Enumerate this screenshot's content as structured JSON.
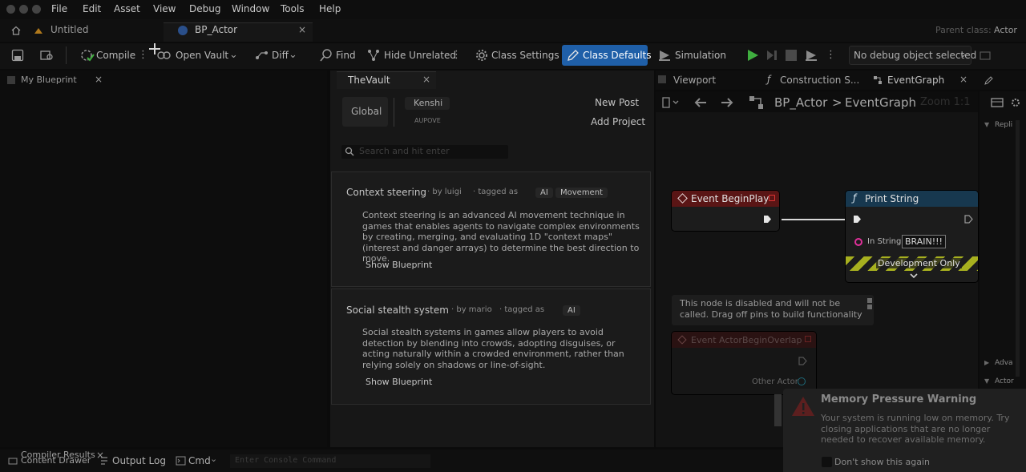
{
  "menu": [
    "File",
    "Edit",
    "Asset",
    "View",
    "Debug",
    "Window",
    "Tools",
    "Help"
  ],
  "tabs": {
    "untitled": "Untitled",
    "bp_actor": "BP_Actor",
    "close": "×"
  },
  "parent_class": {
    "label": "Parent class:",
    "value": "Actor"
  },
  "toolbar": {
    "compile": "Compile",
    "open_vault": "Open Vault",
    "diff": "Diff",
    "find": "Find",
    "hide_unrelated": "Hide Unrelated",
    "class_settings": "Class Settings",
    "class_defaults": "Class Defaults",
    "simulation": "Simulation",
    "debug_object": "No debug object selected"
  },
  "left_panel": {
    "title": "My Blueprint",
    "close": "×"
  },
  "vault": {
    "title": "TheVault",
    "close": "×",
    "scope": "Global",
    "user_name": "Kenshi",
    "user_sub": "AUPOVE",
    "new_post": "New Post",
    "add_project": "Add Project",
    "search_placeholder": "Search and hit enter",
    "posts": [
      {
        "title": "Context steering",
        "author": "by luigi",
        "tagged": "tagged as",
        "tags": [
          "AI",
          "Movement"
        ],
        "description": "Context steering is an advanced AI movement technique in games that enables agents to navigate complex environments by creating, merging, and evaluating 1D \"context maps\" (interest and danger arrays) to determine the best direction to move.",
        "show": "Show Blueprint"
      },
      {
        "title": "Social stealth system",
        "author": "by mario",
        "tagged": "tagged as",
        "tags": [
          "AI"
        ],
        "description": "Social stealth systems in games allow players to avoid detection by blending into crowds, adopting disguises, or acting naturally within a crowded environment, rather than relying solely on shadows or line-of-sight.",
        "show": "Show Blueprint"
      }
    ]
  },
  "graph_tabs": {
    "viewport": "Viewport",
    "construction": "Construction S...",
    "eventgraph": "EventGraph"
  },
  "breadcrumb": {
    "root": "BP_Actor",
    "sep": ">",
    "current": "EventGraph",
    "zoom": "Zoom 1:1"
  },
  "nodes": {
    "begin_play": "Event BeginPlay",
    "print_string": "Print String",
    "in_string_label": "In String",
    "in_string_value": "BRAIN!!!",
    "dev_only": "Development Only",
    "disabled_note": "This node is disabled and will not be called. Drag off pins to build functionality",
    "overlap": "Event ActorBeginOverlap",
    "other_actor": "Other Actor"
  },
  "details_panel": {
    "item1": "Repli",
    "item2": "Adva",
    "item3": "Actor"
  },
  "bottom": {
    "content_drawer": "Content Drawer",
    "compiler_results": "Compiler Results",
    "output_log": "Output Log",
    "cmd": "Cmd",
    "console_placeholder": "Enter Console Command"
  },
  "notification": {
    "title": "Memory Pressure Warning",
    "body": "Your system is running low on memory. Try closing applications that are no longer needed to recover available memory.",
    "checkbox": "Don't show this again"
  },
  "colors": {
    "accent": "#1f5fa8",
    "play": "#3fae3f",
    "event_header": "#5a1515",
    "function_header": "#17384f"
  }
}
